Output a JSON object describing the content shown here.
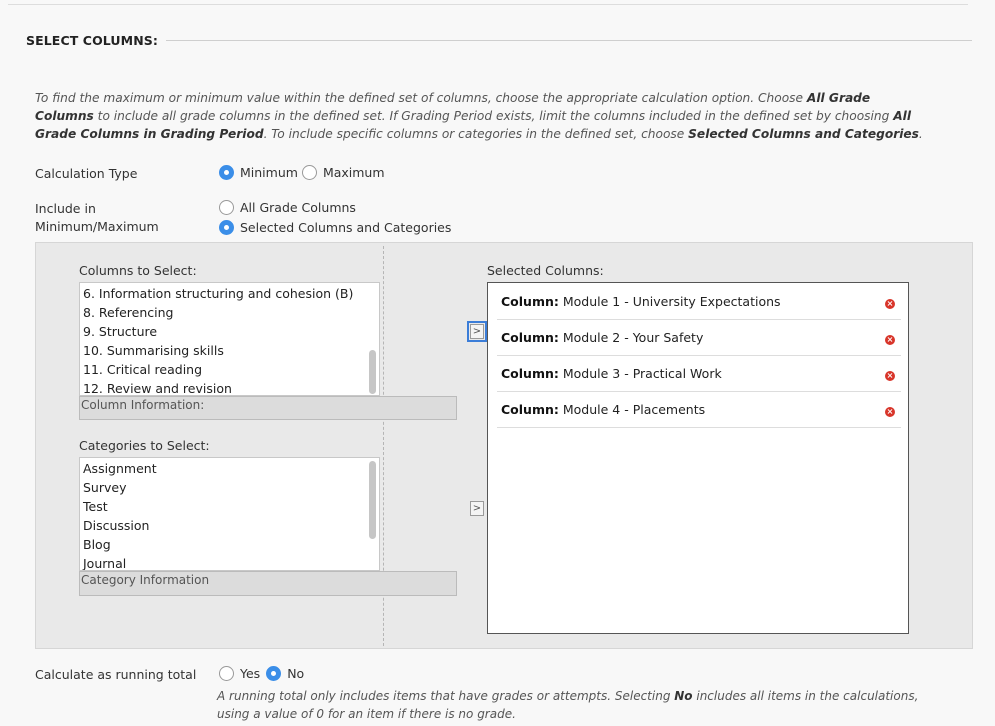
{
  "section": {
    "title": "SELECT COLUMNS:"
  },
  "instructions": {
    "p1": "To find the maximum or minimum value within the defined set of columns, choose the appropriate calculation option. Choose ",
    "b1": "All Grade Columns",
    "p2": " to include all grade columns in the defined set. If Grading Period exists, limit the columns included in the defined set by choosing ",
    "b2": "All Grade Columns in Grading Period",
    "p3": ". To include specific columns or categories in the defined set, choose ",
    "b3": "Selected Columns and Categories",
    "p4": "."
  },
  "calc_type": {
    "label": "Calculation Type",
    "options": [
      {
        "label": "Minimum",
        "checked": true
      },
      {
        "label": "Maximum",
        "checked": false
      }
    ]
  },
  "include_in": {
    "label_line1": "Include in",
    "label_line2": "Minimum/Maximum",
    "options": [
      {
        "label": "All Grade Columns",
        "checked": false
      },
      {
        "label": "Selected Columns and Categories",
        "checked": true
      }
    ]
  },
  "columns_to_select": {
    "label": "Columns to Select:",
    "items": [
      "6. Information structuring and cohesion (B)",
      "8. Referencing",
      "9. Structure",
      "10. Summarising skills",
      "11. Critical reading",
      "12. Review and revision"
    ],
    "info_label": "Column Information:"
  },
  "categories_to_select": {
    "label": "Categories to Select:",
    "items": [
      "Assignment",
      "Survey",
      "Test",
      "Discussion",
      "Blog",
      "Journal"
    ],
    "info_label": "Category Information"
  },
  "move_button_glyph": ">",
  "selected_columns": {
    "label": "Selected Columns:",
    "prefix": "Column:",
    "remove_glyph": "×",
    "items": [
      "Module 1 - University Expectations",
      "Module 2 - Your Safety",
      "Module 3 - Practical Work",
      "Module 4 - Placements"
    ]
  },
  "running_total": {
    "label": "Calculate as running total",
    "options": [
      {
        "label": "Yes",
        "checked": false
      },
      {
        "label": "No",
        "checked": true
      }
    ],
    "help_p1": "A running total only includes items that have grades or attempts. Selecting ",
    "help_b": "No",
    "help_p2": " includes all items in the calculations, using a value of 0 for an item if there is no grade."
  },
  "colors": {
    "accent": "#3b8ee8",
    "remove": "#d8352a"
  }
}
